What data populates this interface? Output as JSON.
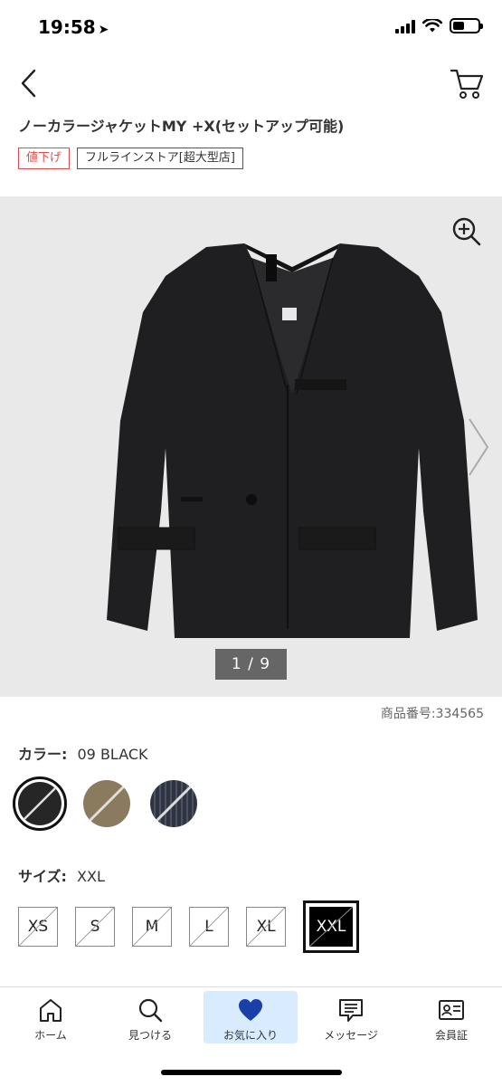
{
  "status_bar": {
    "time": "19:58",
    "location_arrow": "➤"
  },
  "header": {
    "back_icon": "chevron-left-icon",
    "cart_icon": "cart-icon"
  },
  "product": {
    "title": "ノーカラージャケットMY +X(セットアップ可能)",
    "tags": [
      "値下げ",
      "フルラインストア[超大型店]"
    ],
    "image_counter": "1 / 9",
    "item_number": "商品番号:334565"
  },
  "colors": {
    "label": "カラー:",
    "selected_value": "09 BLACK",
    "swatches": [
      {
        "name": "black",
        "color": "#2a2a2a",
        "selected": true
      },
      {
        "name": "olive",
        "color": "#8a7a5e",
        "selected": false
      },
      {
        "name": "navy-stripe",
        "color": "#2f3440",
        "selected": false
      }
    ]
  },
  "sizes": {
    "label": "サイズ:",
    "selected_value": "XXL",
    "options": [
      "XS",
      "S",
      "M",
      "L",
      "XL",
      "XXL"
    ]
  },
  "tab_bar": {
    "tabs": [
      {
        "label": "ホーム",
        "icon": "home-icon"
      },
      {
        "label": "見つける",
        "icon": "search-icon"
      },
      {
        "label": "お気に入り",
        "icon": "heart-icon",
        "active": true
      },
      {
        "label": "メッセージ",
        "icon": "message-icon"
      },
      {
        "label": "会員証",
        "icon": "member-card-icon"
      }
    ]
  },
  "colors_theme": {
    "accent_blue": "#1a3fa8",
    "sale_red": "#e04a4a",
    "active_tab_bg": "#d9ecff"
  }
}
